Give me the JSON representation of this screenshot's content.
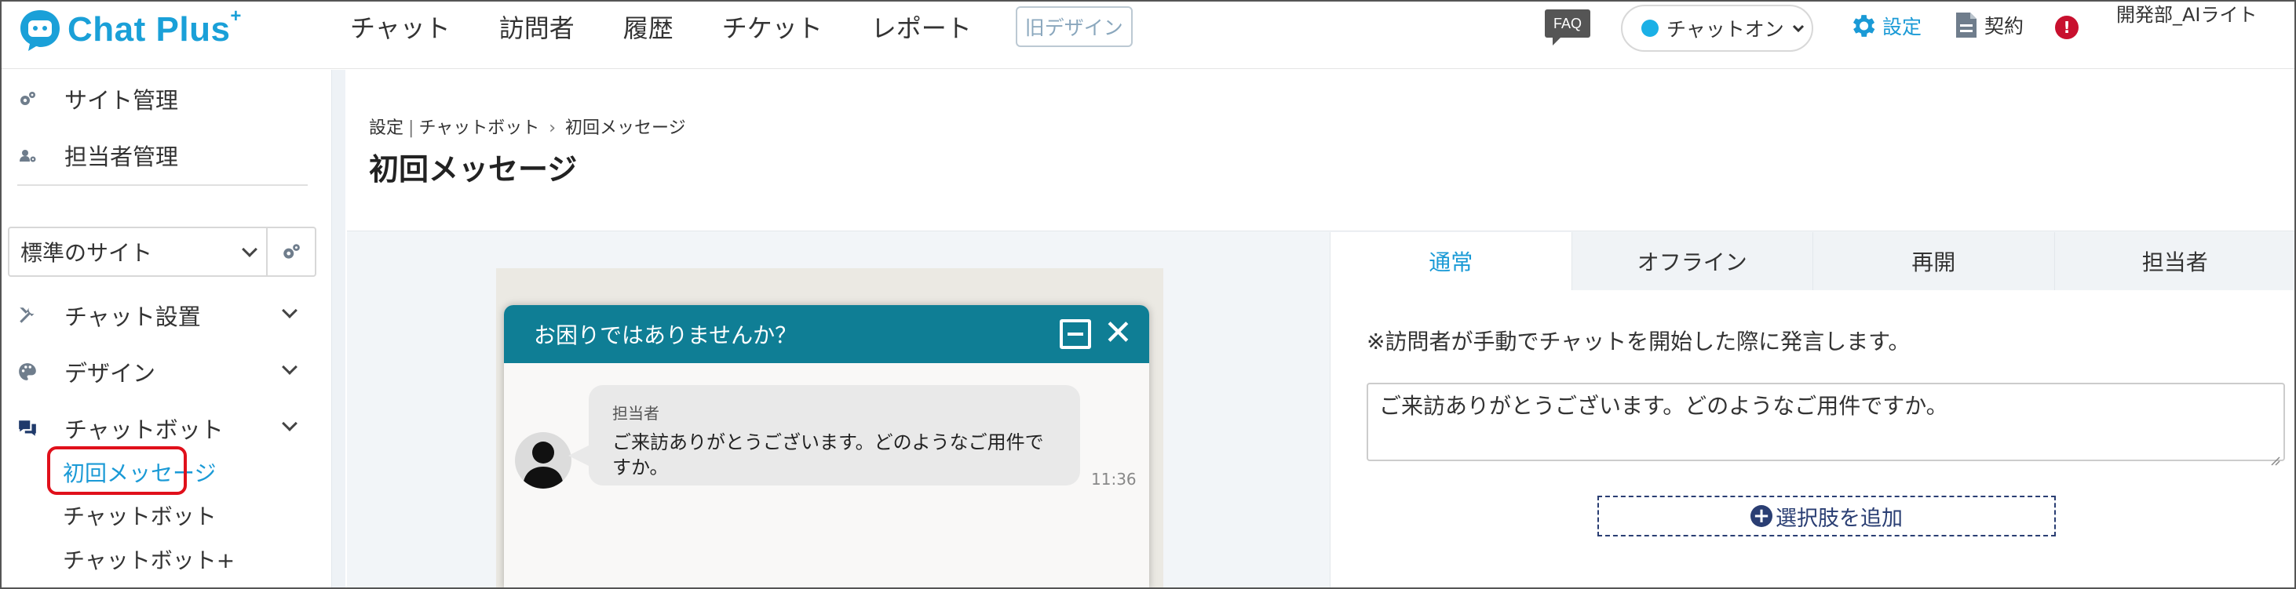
{
  "header": {
    "logo_text": "Chat Plus",
    "logo_sup": "+",
    "nav": [
      "チャット",
      "訪問者",
      "履歴",
      "チケット",
      "レポート"
    ],
    "old_design": "旧デザイン",
    "faq": "FAQ",
    "status": "チャットオン",
    "settings": "設定",
    "contract": "契約",
    "alert": "!",
    "user": "開発部_AIライト"
  },
  "sidebar": {
    "site_admin": "サイト管理",
    "staff_admin": "担当者管理",
    "site_select": "標準のサイト",
    "chat_setup": "チャット設置",
    "design": "デザイン",
    "chatbot": "チャットボット",
    "sub_items": [
      "初回メッセージ",
      "チャットボット",
      "チャットボット+"
    ]
  },
  "breadcrumb": {
    "part1": "設定",
    "part2": "チャットボット",
    "part3": "初回メッセージ"
  },
  "page_title": "初回メッセージ",
  "preview": {
    "header_text": "お困りではありませんか？",
    "sender": "担当者",
    "message": "ご来訪ありがとうございます。どのようなご用件ですか。",
    "time": "11:36"
  },
  "panel": {
    "tabs": [
      "通常",
      "オフライン",
      "再開",
      "担当者"
    ],
    "note": "※訪問者が手動でチャットを開始した際に発言します。",
    "message_value": "ご来訪ありがとうございます。どのようなご用件ですか。",
    "add_choice": "選択肢を追加"
  },
  "colors": {
    "brand": "#1aa0d8",
    "chat_header": "#0f7e95",
    "active_tab": "#1a9ad6",
    "highlight_box": "#e0101b",
    "add_button": "#2a3e73"
  }
}
